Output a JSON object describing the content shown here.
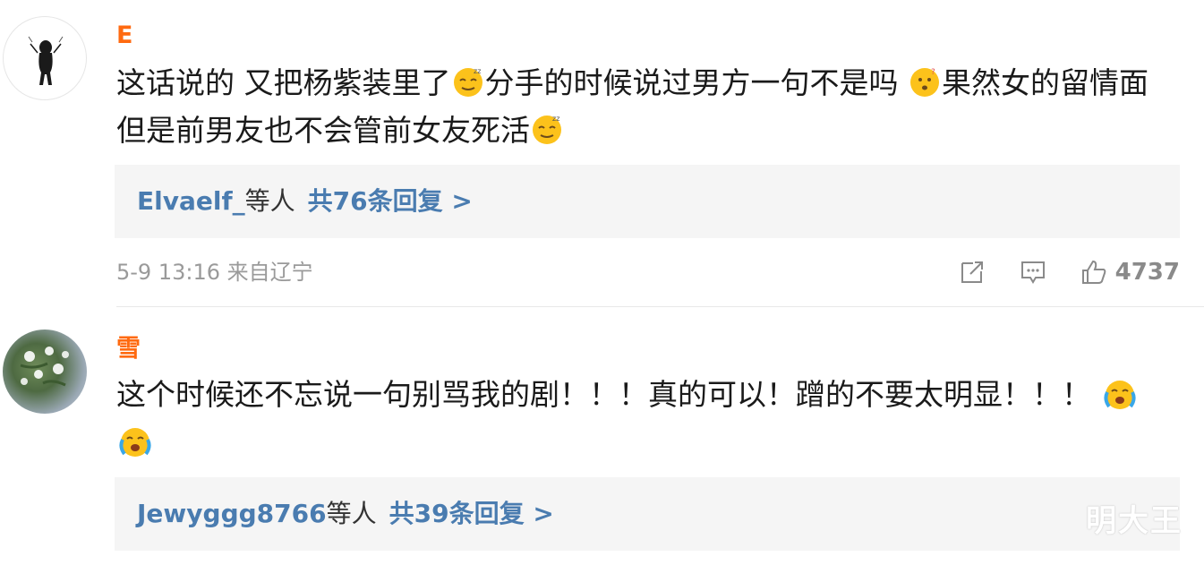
{
  "comments": [
    {
      "username": "E",
      "text_parts": {
        "p1": "这话说的 又把杨紫装里了",
        "p2": "分手的时候说过男方一句不是吗 ",
        "p3": "果然女的留情面 但是前男友也不会管前女友死活"
      },
      "emojis": [
        "dizzy-face-emoji",
        "confused-face-emoji",
        "dizzy-face-emoji"
      ],
      "replies": {
        "names": "Elvaelf_",
        "suffix": "等人",
        "count": "共76条回复 >"
      },
      "timestamp": "5-9 13:16 来自辽宁",
      "likes": "4737"
    },
    {
      "username": "雪",
      "text_parts": {
        "p1": "这个时候还不忘说一句别骂我的剧！！！真的可以！蹭的不要太明显！！！ "
      },
      "emojis": [
        "crying-face-emoji",
        "crying-face-emoji"
      ],
      "replies": {
        "names": "Jewyggg8766",
        "suffix": "等人",
        "count": "共39条回复 >"
      }
    }
  ],
  "watermark": "明大王",
  "colors": {
    "username": "#ff6a10",
    "link": "#4a7cb0",
    "meta": "#9a9a9a",
    "reply_bg": "#f5f5f5"
  },
  "icons": [
    "share-icon",
    "comment-icon",
    "like-icon"
  ]
}
